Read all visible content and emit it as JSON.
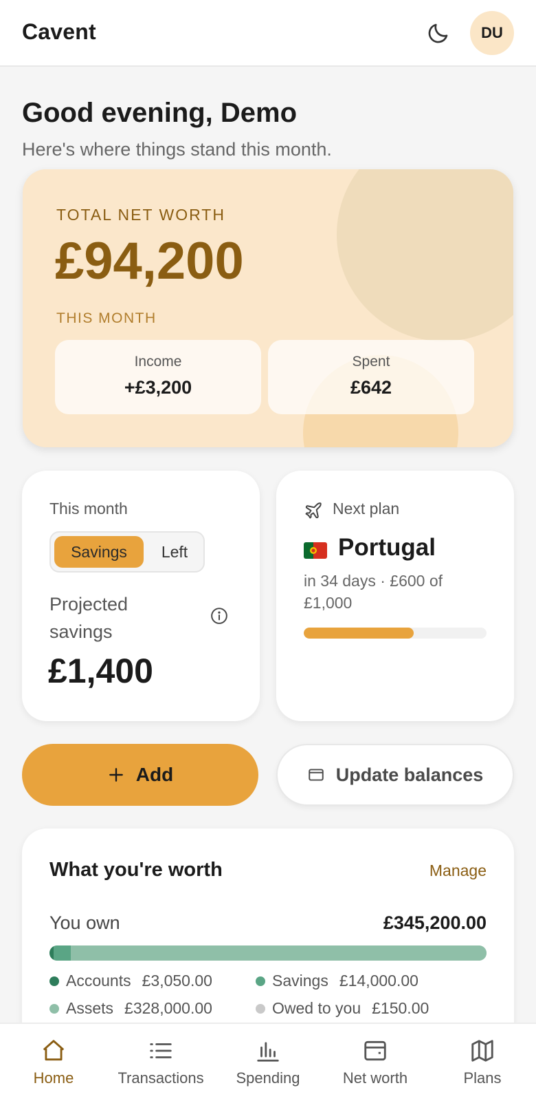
{
  "header": {
    "brand": "Cavent",
    "avatar_initials": "DU",
    "theme_icon": "moon-icon"
  },
  "greeting": {
    "title": "Good evening, Demo",
    "subtitle": "Here's where things stand this month."
  },
  "net_worth": {
    "label": "TOTAL NET WORTH",
    "value": "£94,200",
    "month_label": "THIS MONTH",
    "income": {
      "label": "Income",
      "value": "+£3,200"
    },
    "spent": {
      "label": "Spent",
      "value": "£642"
    }
  },
  "savings_card": {
    "title": "This month",
    "toggle": {
      "selected": "Savings",
      "other": "Left"
    },
    "label": "Projected savings",
    "value": "£1,400"
  },
  "plan_card": {
    "title": "Next plan",
    "destination": "Portugal",
    "detail": "in 34 days · £600 of £1,000",
    "progress_fraction": 0.6
  },
  "actions": {
    "add_label": "Add",
    "update_label": "Update balances"
  },
  "worth_card": {
    "title": "What you're worth",
    "manage_label": "Manage",
    "own_label": "You own",
    "own_value": "£345,200.00",
    "breakdown": [
      {
        "label": "Accounts",
        "value": "£3,050.00",
        "amount": 3050,
        "color": "#2e7d5b"
      },
      {
        "label": "Savings",
        "value": "£14,000.00",
        "amount": 14000,
        "color": "#5aa585"
      },
      {
        "label": "Assets",
        "value": "£328,000.00",
        "amount": 328000,
        "color": "#8fbfa8"
      },
      {
        "label": "Owed to you",
        "value": "£150.00",
        "amount": 150,
        "color": "#c9c9c9"
      }
    ]
  },
  "nav": [
    {
      "label": "Home",
      "icon": "home-icon",
      "active": true
    },
    {
      "label": "Transactions",
      "icon": "list-icon",
      "active": false
    },
    {
      "label": "Spending",
      "icon": "bar-chart-icon",
      "active": false
    },
    {
      "label": "Net worth",
      "icon": "wallet-icon",
      "active": false
    },
    {
      "label": "Plans",
      "icon": "map-icon",
      "active": false
    }
  ],
  "colors": {
    "accent": "#e8a33d",
    "brand_brown": "#8a5d12",
    "hero_bg": "#fbe7cb"
  }
}
